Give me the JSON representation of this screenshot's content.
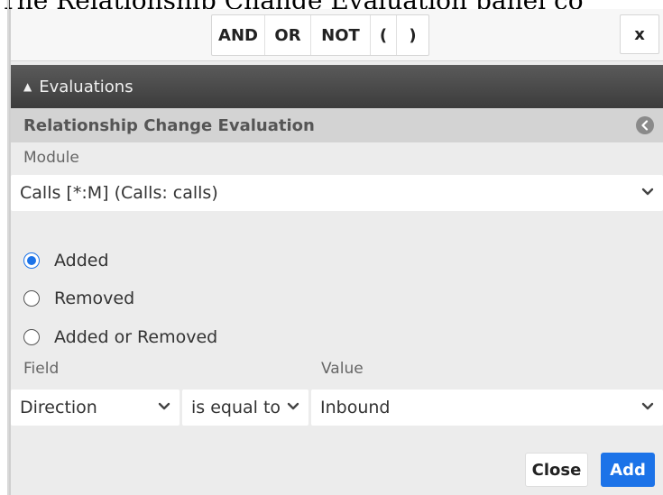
{
  "caption": "The Relationship Change Evaluation panel co",
  "toolbar": {
    "operators": [
      "AND",
      "OR",
      "NOT",
      "(",
      ")"
    ],
    "close_label": "x"
  },
  "evaluations": {
    "title": "Evaluations",
    "caret_icon": "caret-up-icon"
  },
  "evaluation": {
    "title": "Relationship Change Evaluation",
    "back_icon": "arrow-left-circle-icon"
  },
  "module": {
    "label": "Module",
    "value": "Calls [*:M] (Calls: calls)"
  },
  "change_options": [
    {
      "label": "Added",
      "checked": true
    },
    {
      "label": "Removed",
      "checked": false
    },
    {
      "label": "Added or Removed",
      "checked": false
    }
  ],
  "condition": {
    "field_label": "Field",
    "value_label": "Value",
    "field_value": "Direction",
    "operator_value": "is equal to",
    "value_value": "Inbound"
  },
  "buttons": {
    "close": "Close",
    "add": "Add"
  },
  "colors": {
    "accent": "#1c73e8",
    "header_dark": "#4a4a4a",
    "subheader": "#d3d3d3",
    "panel": "#ececec"
  }
}
